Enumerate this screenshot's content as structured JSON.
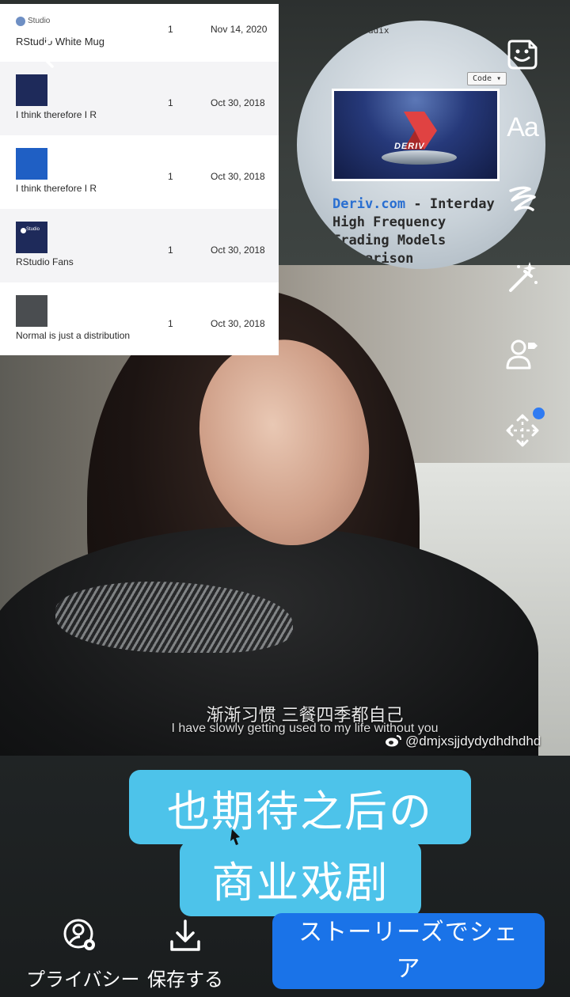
{
  "purchases_table": {
    "rows": [
      {
        "thumb_text": "Studio",
        "name": "RStudio White Mug",
        "qty": "1",
        "date": "Nov 14, 2020",
        "thumb_color": "#ffffff"
      },
      {
        "thumb_text": "",
        "name": "I think therefore I R",
        "qty": "1",
        "date": "Oct 30, 2018",
        "thumb_color": "#1e2a5a"
      },
      {
        "thumb_text": "",
        "name": "I think therefore I R",
        "qty": "1",
        "date": "Oct 30, 2018",
        "thumb_color": "#1f5fc4"
      },
      {
        "thumb_text": "Studio",
        "name": "RStudio Fans",
        "qty": "1",
        "date": "Oct 30, 2018",
        "thumb_color": "#1e2a5a"
      },
      {
        "thumb_text": "",
        "name": "Normal is just a distribution",
        "qty": "1",
        "date": "Oct 30, 2018",
        "thumb_color": "#4a4d50"
      }
    ]
  },
  "deriv_sticker": {
    "top_text": "adix",
    "code_button": "Code ▾",
    "stage_word": "DERIV",
    "brand": "Deriv.com",
    "line1_rest": " - Interday",
    "line2": "High Frequency",
    "line3": "Trading Models",
    "line4": "Comparison"
  },
  "subtitles": {
    "chinese": "渐渐习惯 三餐四季都自己",
    "english": "I have slowly getting used to my life without you"
  },
  "watermark": "@dmjxsjjdydydhdhdhd",
  "captions": {
    "line1": "也期待之后の",
    "line2": "商业戏剧"
  },
  "tools": {
    "text_tool": "Aa",
    "icons": [
      "sticker-icon",
      "text-tool",
      "draw-icon",
      "effects-wand-icon",
      "tag-people-icon",
      "move-icon"
    ]
  },
  "actions": {
    "privacy_label": "プライバシー",
    "save_label": "保存する",
    "share_label": "ストーリーズでシェア"
  },
  "colors": {
    "caption_bg": "#4dc3ea",
    "share_button": "#1a73e8",
    "notification_dot": "#2f7bf2"
  }
}
